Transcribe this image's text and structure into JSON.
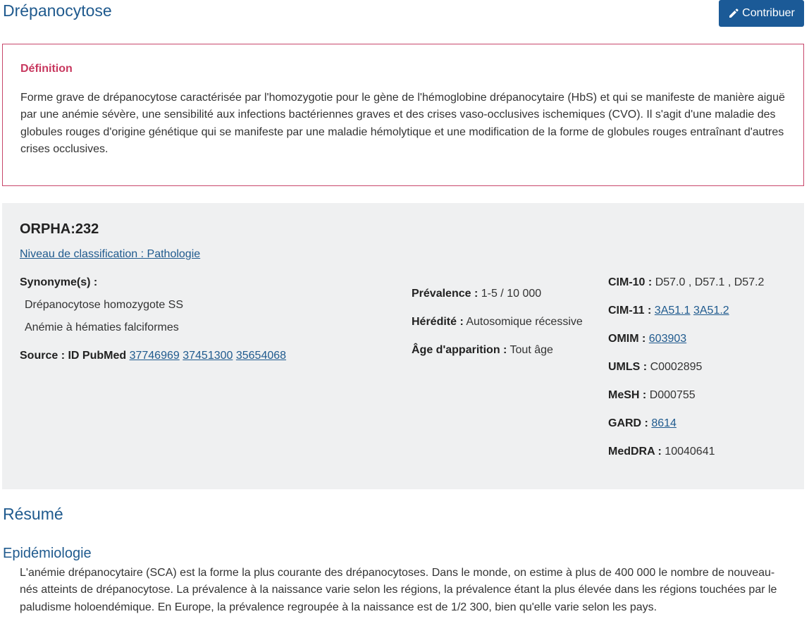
{
  "page": {
    "title": "Drépanocytose",
    "contribute_label": "Contribuer"
  },
  "definition": {
    "heading": "Définition",
    "text": "Forme grave de drépanocytose caractérisée par l'homozygotie pour le gène de l'hémoglobine drépanocytaire (HbS) et qui se manifeste de manière aiguë par une anémie sévère, une sensibilité aux infections bactériennes graves et des crises vaso-occlusives ischemiques (CVO). Il s'agit d'une maladie des globules rouges d'origine génétique qui se manifeste par une maladie hémolytique et une modification de la forme de globules rouges entraînant d'autres crises occlusives."
  },
  "info": {
    "orpha_code": "ORPHA:232",
    "classification_link": "Niveau de classification : Pathologie",
    "synonyms_label": "Synonyme(s) :",
    "synonyms": [
      "Drépanocytose homozygote SS",
      "Anémie à hématies falciformes"
    ],
    "source_label": "Source : ID PubMed",
    "source_ids": [
      "37746969",
      "37451300",
      "35654068"
    ],
    "prevalence_label": "Prévalence :",
    "prevalence_value": "1-5 / 10 000",
    "heredity_label": "Hérédité :",
    "heredity_value": "Autosomique récessive",
    "onset_label": "Âge d'apparition :",
    "onset_value": "Tout âge",
    "cim10_label": "CIM-10 :",
    "cim10_value": "D57.0 , D57.1 , D57.2",
    "cim11_label": "CIM-11 :",
    "cim11_links": [
      "3A51.1",
      "3A51.2"
    ],
    "omim_label": "OMIM :",
    "omim_link": "603903",
    "umls_label": "UMLS :",
    "umls_value": "C0002895",
    "mesh_label": "MeSH :",
    "mesh_value": "D000755",
    "gard_label": "GARD :",
    "gard_link": "8614",
    "meddra_label": "MedDRA :",
    "meddra_value": "10040641"
  },
  "summary": {
    "title": "Résumé",
    "epidemiology_title": "Epidémiologie",
    "epidemiology_text": "L'anémie drépanocytaire (SCA) est la forme la plus courante des drépanocytoses. Dans le monde, on estime à plus de 400 000 le nombre de nouveau-nés atteints de drépanocytose. La prévalence à la naissance varie selon les régions, la prévalence étant la plus élevée dans les régions touchées par le paludisme holoendémique. En Europe, la prévalence regroupée à la naissance est de 1/2 300, bien qu'elle varie selon les pays."
  },
  "colors": {
    "title_blue": "#1f5a8e",
    "button_blue": "#1b5a97",
    "definition_border": "#c8476b",
    "definition_heading": "#c8385f",
    "panel_bg": "#eff0f1"
  },
  "icons": {
    "contribute": "pencil-icon"
  }
}
